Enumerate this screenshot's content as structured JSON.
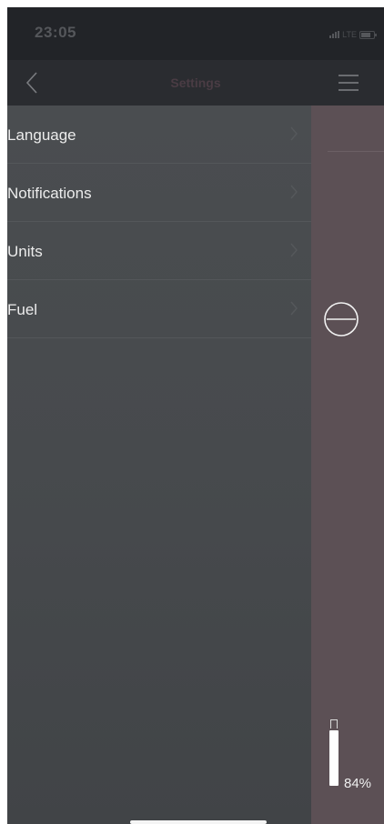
{
  "status_bar": {
    "time": "23:05",
    "network": "LTE",
    "icons": [
      "signal-icon",
      "battery-icon"
    ]
  },
  "nav": {
    "title": "Settings",
    "back_icon": "chevron-left-icon",
    "menu_icon": "hamburger-menu-icon"
  },
  "settings": {
    "items": [
      {
        "label": "Language"
      },
      {
        "label": "Notifications"
      },
      {
        "label": "Units"
      },
      {
        "label": "Fuel"
      }
    ]
  },
  "side_panel": {
    "action_icon": "minus-circle-icon",
    "battery_level_percent": 84,
    "battery_text": "84%"
  },
  "colors": {
    "status_bar_bg": "#222428",
    "nav_bar_bg": "#2a2c30",
    "drawer_bg": "#484b4e",
    "side_panel_bg": "#5c5055",
    "label_text": "#ececec",
    "title_text": "#4a3c44"
  }
}
